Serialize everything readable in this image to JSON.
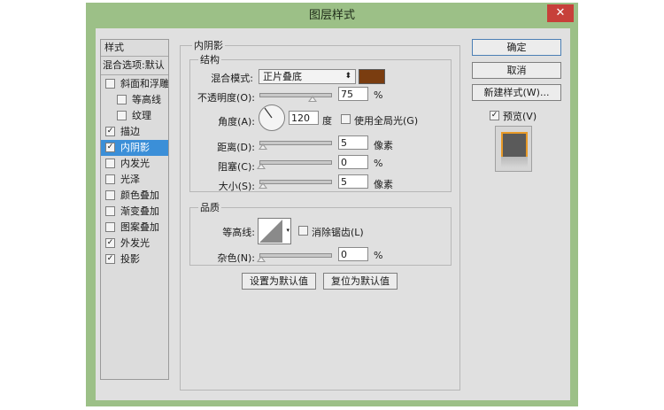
{
  "window": {
    "title": "图层样式",
    "close_glyph": "✕"
  },
  "style_list": {
    "header": "样式",
    "blend_options": "混合选项:默认",
    "items": [
      {
        "label": "斜面和浮雕",
        "checked": false
      },
      {
        "label": "等高线",
        "checked": false
      },
      {
        "label": "纹理",
        "checked": false
      },
      {
        "label": "描边",
        "checked": true
      },
      {
        "label": "内阴影",
        "checked": true,
        "selected": true
      },
      {
        "label": "内发光",
        "checked": false
      },
      {
        "label": "光泽",
        "checked": false
      },
      {
        "label": "颜色叠加",
        "checked": false
      },
      {
        "label": "渐变叠加",
        "checked": false
      },
      {
        "label": "图案叠加",
        "checked": false
      },
      {
        "label": "外发光",
        "checked": true
      },
      {
        "label": "投影",
        "checked": true
      }
    ]
  },
  "inner_shadow": {
    "title": "内阴影",
    "structure": {
      "title": "结构",
      "blend_mode_label": "混合模式:",
      "blend_mode_value": "正片叠底",
      "shadow_color": "#7a3d10",
      "opacity_label": "不透明度(O):",
      "opacity_value": "75",
      "opacity_unit": "%",
      "angle_label": "角度(A):",
      "angle_value": "120",
      "angle_unit": "度",
      "global_light_label": "使用全局光(G)",
      "distance_label": "距离(D):",
      "distance_value": "5",
      "distance_unit": "像素",
      "choke_label": "阻塞(C):",
      "choke_value": "0",
      "choke_unit": "%",
      "size_label": "大小(S):",
      "size_value": "5",
      "size_unit": "像素"
    },
    "quality": {
      "title": "品质",
      "contour_label": "等高线:",
      "anti_alias_label": "消除锯齿(L)",
      "noise_label": "杂色(N):",
      "noise_value": "0",
      "noise_unit": "%"
    },
    "set_default": "设置为默认值",
    "reset_default": "复位为默认值"
  },
  "buttons": {
    "ok": "确定",
    "cancel": "取消",
    "new_style": "新建样式(W)...",
    "preview_label": "预览(V)",
    "preview_checked": true
  }
}
